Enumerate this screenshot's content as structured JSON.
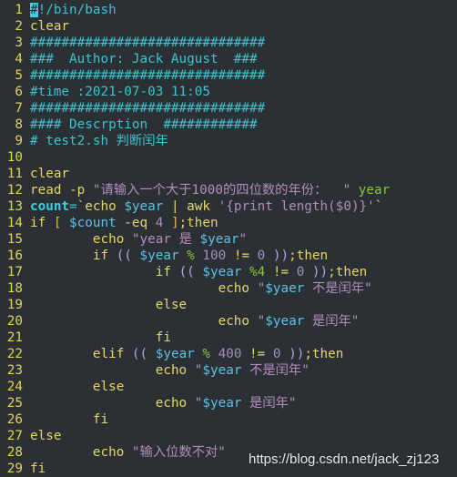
{
  "editor": {
    "language": "bash",
    "lines": [
      {
        "n": "1",
        "tokens": [
          [
            "cursor",
            "#"
          ],
          [
            "comment",
            "!/bin/bash"
          ]
        ]
      },
      {
        "n": "2",
        "tokens": [
          [
            "kw",
            "clear"
          ]
        ]
      },
      {
        "n": "3",
        "tokens": [
          [
            "comment",
            "##############################"
          ]
        ]
      },
      {
        "n": "4",
        "tokens": [
          [
            "comment",
            "###  Author: Jack August  ###"
          ]
        ]
      },
      {
        "n": "5",
        "tokens": [
          [
            "comment",
            "##############################"
          ]
        ]
      },
      {
        "n": "6",
        "tokens": [
          [
            "comment",
            "#time :2021-07-03 11:05"
          ]
        ]
      },
      {
        "n": "7",
        "tokens": [
          [
            "comment",
            "##############################"
          ]
        ]
      },
      {
        "n": "8",
        "tokens": [
          [
            "comment",
            "#### Descrption  ############"
          ]
        ]
      },
      {
        "n": "9",
        "tokens": [
          [
            "comment",
            "# test2.sh 判断闰年"
          ]
        ]
      },
      {
        "n": "10",
        "tokens": []
      },
      {
        "n": "11",
        "tokens": [
          [
            "kw",
            "clear"
          ]
        ]
      },
      {
        "n": "12",
        "tokens": [
          [
            "kw",
            "read "
          ],
          [
            "plain",
            "-p "
          ],
          [
            "str",
            "\"请输入一个大于1000的四位数的年份：  \""
          ],
          [
            "plain",
            " "
          ],
          [
            "green",
            "year"
          ]
        ]
      },
      {
        "n": "13",
        "tokens": [
          [
            "bold",
            "count"
          ],
          [
            "comment",
            "="
          ],
          [
            "kw",
            "`echo "
          ],
          [
            "var",
            "$year"
          ],
          [
            "kw",
            " | awk "
          ],
          [
            "str",
            "'{print length($0)}'"
          ],
          [
            "kw",
            "`"
          ]
        ]
      },
      {
        "n": "14",
        "tokens": [
          [
            "kw",
            "if "
          ],
          [
            "bracket",
            "[ "
          ],
          [
            "var",
            "$count"
          ],
          [
            "kw",
            " -eq "
          ],
          [
            "num",
            "4"
          ],
          [
            "kw",
            " "
          ],
          [
            "bracket",
            "]"
          ],
          [
            "kw",
            ";then"
          ]
        ]
      },
      {
        "n": "15",
        "tokens": [
          [
            "plain",
            "        "
          ],
          [
            "kw",
            "echo "
          ],
          [
            "str",
            "\"year 是 "
          ],
          [
            "var",
            "$year"
          ],
          [
            "str",
            "\""
          ]
        ]
      },
      {
        "n": "16",
        "tokens": [
          [
            "plain",
            "        "
          ],
          [
            "kw",
            "if "
          ],
          [
            "paren",
            "(( "
          ],
          [
            "var",
            "$year"
          ],
          [
            "op",
            " % "
          ],
          [
            "num",
            "100"
          ],
          [
            "kw",
            " != "
          ],
          [
            "num",
            "0"
          ],
          [
            "paren",
            " ))"
          ],
          [
            "kw",
            ";then"
          ]
        ]
      },
      {
        "n": "17",
        "tokens": [
          [
            "plain",
            "                "
          ],
          [
            "kw",
            "if "
          ],
          [
            "paren",
            "(( "
          ],
          [
            "var",
            "$year"
          ],
          [
            "op",
            " %4"
          ],
          [
            "kw",
            " != "
          ],
          [
            "num",
            "0"
          ],
          [
            "paren",
            " ))"
          ],
          [
            "kw",
            ";then"
          ]
        ]
      },
      {
        "n": "18",
        "tokens": [
          [
            "plain",
            "                        "
          ],
          [
            "kw",
            "echo "
          ],
          [
            "str",
            "\""
          ],
          [
            "var",
            "$yaer"
          ],
          [
            "str",
            " 不是闰年\""
          ]
        ]
      },
      {
        "n": "19",
        "tokens": [
          [
            "plain",
            "                "
          ],
          [
            "kw",
            "else"
          ]
        ]
      },
      {
        "n": "20",
        "tokens": [
          [
            "plain",
            "                        "
          ],
          [
            "kw",
            "echo "
          ],
          [
            "str",
            "\""
          ],
          [
            "var",
            "$year"
          ],
          [
            "str",
            " 是闰年\""
          ]
        ]
      },
      {
        "n": "21",
        "tokens": [
          [
            "plain",
            "                "
          ],
          [
            "kw",
            "fi"
          ]
        ]
      },
      {
        "n": "22",
        "tokens": [
          [
            "plain",
            "        "
          ],
          [
            "kw",
            "elif "
          ],
          [
            "paren",
            "(( "
          ],
          [
            "var",
            "$year"
          ],
          [
            "op",
            " % "
          ],
          [
            "num",
            "400"
          ],
          [
            "kw",
            " != "
          ],
          [
            "num",
            "0"
          ],
          [
            "paren",
            " ))"
          ],
          [
            "kw",
            ";then"
          ]
        ]
      },
      {
        "n": "23",
        "tokens": [
          [
            "plain",
            "                "
          ],
          [
            "kw",
            "echo "
          ],
          [
            "str",
            "\""
          ],
          [
            "var",
            "$year"
          ],
          [
            "str",
            " 不是闰年\""
          ]
        ]
      },
      {
        "n": "24",
        "tokens": [
          [
            "plain",
            "        "
          ],
          [
            "kw",
            "else"
          ]
        ]
      },
      {
        "n": "25",
        "tokens": [
          [
            "plain",
            "                "
          ],
          [
            "kw",
            "echo "
          ],
          [
            "str",
            "\""
          ],
          [
            "var",
            "$year"
          ],
          [
            "str",
            " 是闰年\""
          ]
        ]
      },
      {
        "n": "26",
        "tokens": [
          [
            "plain",
            "        "
          ],
          [
            "kw",
            "fi"
          ]
        ]
      },
      {
        "n": "27",
        "tokens": [
          [
            "kw",
            "else"
          ]
        ]
      },
      {
        "n": "28",
        "tokens": [
          [
            "plain",
            "        "
          ],
          [
            "kw",
            "echo "
          ],
          [
            "str",
            "\"输入位数不对\""
          ]
        ]
      },
      {
        "n": "29",
        "tokens": [
          [
            "kw",
            "fi"
          ]
        ]
      }
    ]
  },
  "watermark": "https://blog.csdn.net/jack_zj123",
  "colors": {
    "background": "#2b3034",
    "line_number": "#e2d25a",
    "comment": "#3cc4d0",
    "keyword": "#e6d66a",
    "string": "#b48cbc",
    "variable": "#5cc2e8",
    "number": "#a88cc0",
    "operator": "#8cc43c"
  }
}
